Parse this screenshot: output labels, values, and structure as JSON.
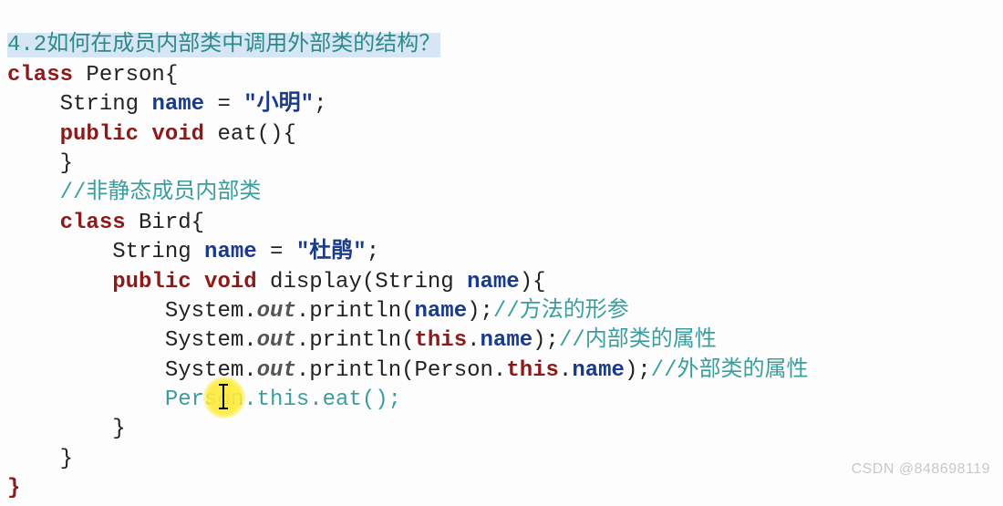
{
  "heading": "4.2如何在成员内部类中调用外部类的结构？",
  "code": {
    "l1": {
      "a": "class ",
      "b": "Person",
      "c": "{"
    },
    "l2": {
      "a": "    String ",
      "b": "name",
      "c": " = ",
      "d": "\"小明\"",
      "e": ";"
    },
    "l3": {
      "a": "    ",
      "b": "public void ",
      "c": "eat(){"
    },
    "l4": {
      "a": "    }"
    },
    "l5": {
      "a": "    ",
      "b": "//非静态成员内部类"
    },
    "l6": {
      "a": "    ",
      "b": "class ",
      "c": "Bird",
      "d": "{"
    },
    "l7": {
      "a": "        String ",
      "b": "name",
      "c": " = ",
      "d": "\"杜鹃\"",
      "e": ";"
    },
    "l8": {
      "a": "        ",
      "b": "public void ",
      "c": "display(String ",
      "d": "name",
      "e": "){"
    },
    "l9": {
      "a": "            System.",
      "b": "out",
      "c": ".println(",
      "d": "name",
      "e": ");",
      "f": "//方法的形参"
    },
    "l10": {
      "a": "            System.",
      "b": "out",
      "c": ".println(",
      "d": "this",
      "e": ".",
      "f": "name",
      "g": ");",
      "h": "//内部类的属性"
    },
    "l11": {
      "a": "            System.",
      "b": "out",
      "c": ".println(Person.",
      "d": "this",
      "e": ".",
      "f": "name",
      "g": ");",
      "h": "//外部类的属性"
    },
    "l12": {
      "a": "            ",
      "b": "Person.this.eat();"
    },
    "l13": {
      "a": "        }"
    },
    "l14": {
      "a": "    }"
    },
    "l15": {
      "a": "}"
    }
  },
  "watermark": "CSDN @848698119"
}
